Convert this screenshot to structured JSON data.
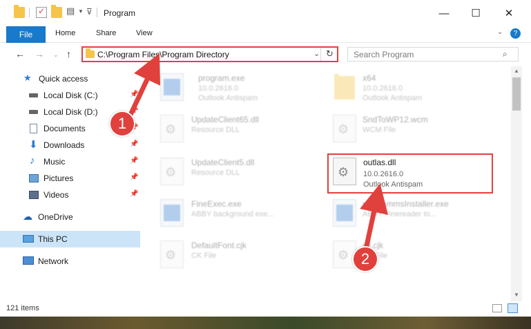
{
  "window": {
    "title": "Program",
    "controls": {
      "minimize": "—",
      "maximize": "☐",
      "close": "✕"
    }
  },
  "ribbon": {
    "file": "File",
    "tabs": [
      "Home",
      "Share",
      "View"
    ],
    "help": "?"
  },
  "address": {
    "path": "C:\\Program Files\\Program Directory"
  },
  "search": {
    "placeholder": "Search Program"
  },
  "sidebar": {
    "items": [
      {
        "label": "Quick access",
        "icon": "star-icon",
        "pinned": false
      },
      {
        "label": "Local Disk (C:)",
        "icon": "drive-icon",
        "pinned": true
      },
      {
        "label": "Local Disk (D:)",
        "icon": "drive-icon",
        "pinned": true
      },
      {
        "label": "Documents",
        "icon": "documents-icon",
        "pinned": true
      },
      {
        "label": "Downloads",
        "icon": "download-icon",
        "pinned": true
      },
      {
        "label": "Music",
        "icon": "music-icon",
        "pinned": true
      },
      {
        "label": "Pictures",
        "icon": "pictures-icon",
        "pinned": true
      },
      {
        "label": "Videos",
        "icon": "videos-icon",
        "pinned": true
      },
      {
        "label": "OneDrive",
        "icon": "cloud-icon",
        "pinned": false
      },
      {
        "label": "This PC",
        "icon": "computer-icon",
        "pinned": false
      },
      {
        "label": "Network",
        "icon": "network-icon",
        "pinned": false
      }
    ]
  },
  "files": [
    {
      "name": "program.exe",
      "line2": "10.0.2616.0",
      "line3": "Outlook Antispam",
      "icon": "exe-icon"
    },
    {
      "name": "x64",
      "line2": "10.0.2616.0",
      "line3": "Outlook Antispam",
      "icon": "folder-icon"
    },
    {
      "name": "UpdateClient65.dll",
      "line2": "Resource DLL",
      "line3": "",
      "icon": "dll-icon"
    },
    {
      "name": "SndToWP12.wcm",
      "line2": "WCM File",
      "line3": "",
      "icon": "file-icon"
    },
    {
      "name": "UpdateClient5.dll",
      "line2": "Resource DLL",
      "line3": "",
      "icon": "dll-icon"
    },
    {
      "name": "outlas.dll",
      "line2": "10.0.2616.0",
      "line3": "Outlook Antispam",
      "icon": "dll-icon"
    },
    {
      "name": "FineExec.exe",
      "line2": "ABBY background exe...",
      "line3": "",
      "icon": "exe-icon"
    },
    {
      "name": "programmsInstaller.exe",
      "line2": "ABBY Finereader to...",
      "line3": "",
      "icon": "exe-icon"
    },
    {
      "name": "DefaultFont.cjk",
      "line2": "CK File",
      "line3": "",
      "icon": "file-icon"
    },
    {
      "name": "dll.cjk",
      "line2": "CK File",
      "line3": "",
      "icon": "file-icon"
    }
  ],
  "status": {
    "count": "121 items"
  },
  "annotations": {
    "step1": "1",
    "step2": "2",
    "color": "#e0413d"
  },
  "colors": {
    "accent": "#1979ca"
  }
}
